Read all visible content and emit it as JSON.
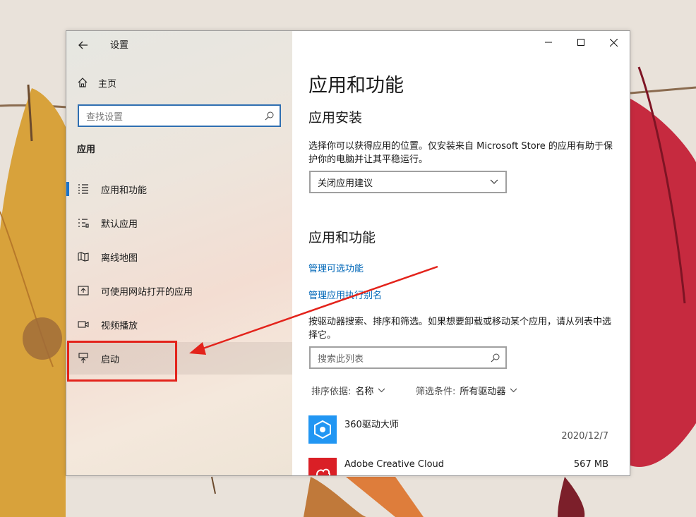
{
  "window": {
    "title": "设置",
    "back_icon": "back-arrow-icon",
    "minimize_icon": "minimize-icon",
    "maximize_icon": "maximize-icon",
    "close_icon": "close-icon"
  },
  "sidebar": {
    "home_label": "主页",
    "home_icon": "home-icon",
    "search_placeholder": "查找设置",
    "search_icon": "search-icon",
    "section_title": "应用",
    "items": [
      {
        "label": "应用和功能",
        "icon": "list-icon",
        "selected": true
      },
      {
        "label": "默认应用",
        "icon": "default-apps-icon",
        "selected": false
      },
      {
        "label": "离线地图",
        "icon": "map-icon",
        "selected": false
      },
      {
        "label": "可使用网站打开的应用",
        "icon": "open-web-icon",
        "selected": false
      },
      {
        "label": "视频播放",
        "icon": "video-icon",
        "selected": false
      },
      {
        "label": "启动",
        "icon": "startup-icon",
        "selected": false,
        "hovered": true
      }
    ]
  },
  "main": {
    "page_title": "应用和功能",
    "install_heading": "应用安装",
    "install_desc": "选择你可以获得应用的位置。仅安装来自 Microsoft Store 的应用有助于保护你的电脑并让其平稳运行。",
    "install_dropdown_value": "关闭应用建议",
    "apps_heading": "应用和功能",
    "link_optional_features": "管理可选功能",
    "link_app_alias": "管理应用执行别名",
    "list_desc": "按驱动器搜索、排序和筛选。如果想要卸载或移动某个应用，请从列表中选择它。",
    "list_search_placeholder": "搜索此列表",
    "sort_label": "排序依据:",
    "sort_value": "名称",
    "filter_label": "筛选条件:",
    "filter_value": "所有驱动器",
    "apps": [
      {
        "name": "360驱动大师",
        "date": "2020/12/7",
        "size": ""
      },
      {
        "name": "Adobe Creative Cloud",
        "date": "",
        "size": "567 MB"
      }
    ]
  },
  "colors": {
    "accent": "#0067b8",
    "selection_bar": "#1a73c9",
    "annotation_red": "#e3231b"
  }
}
